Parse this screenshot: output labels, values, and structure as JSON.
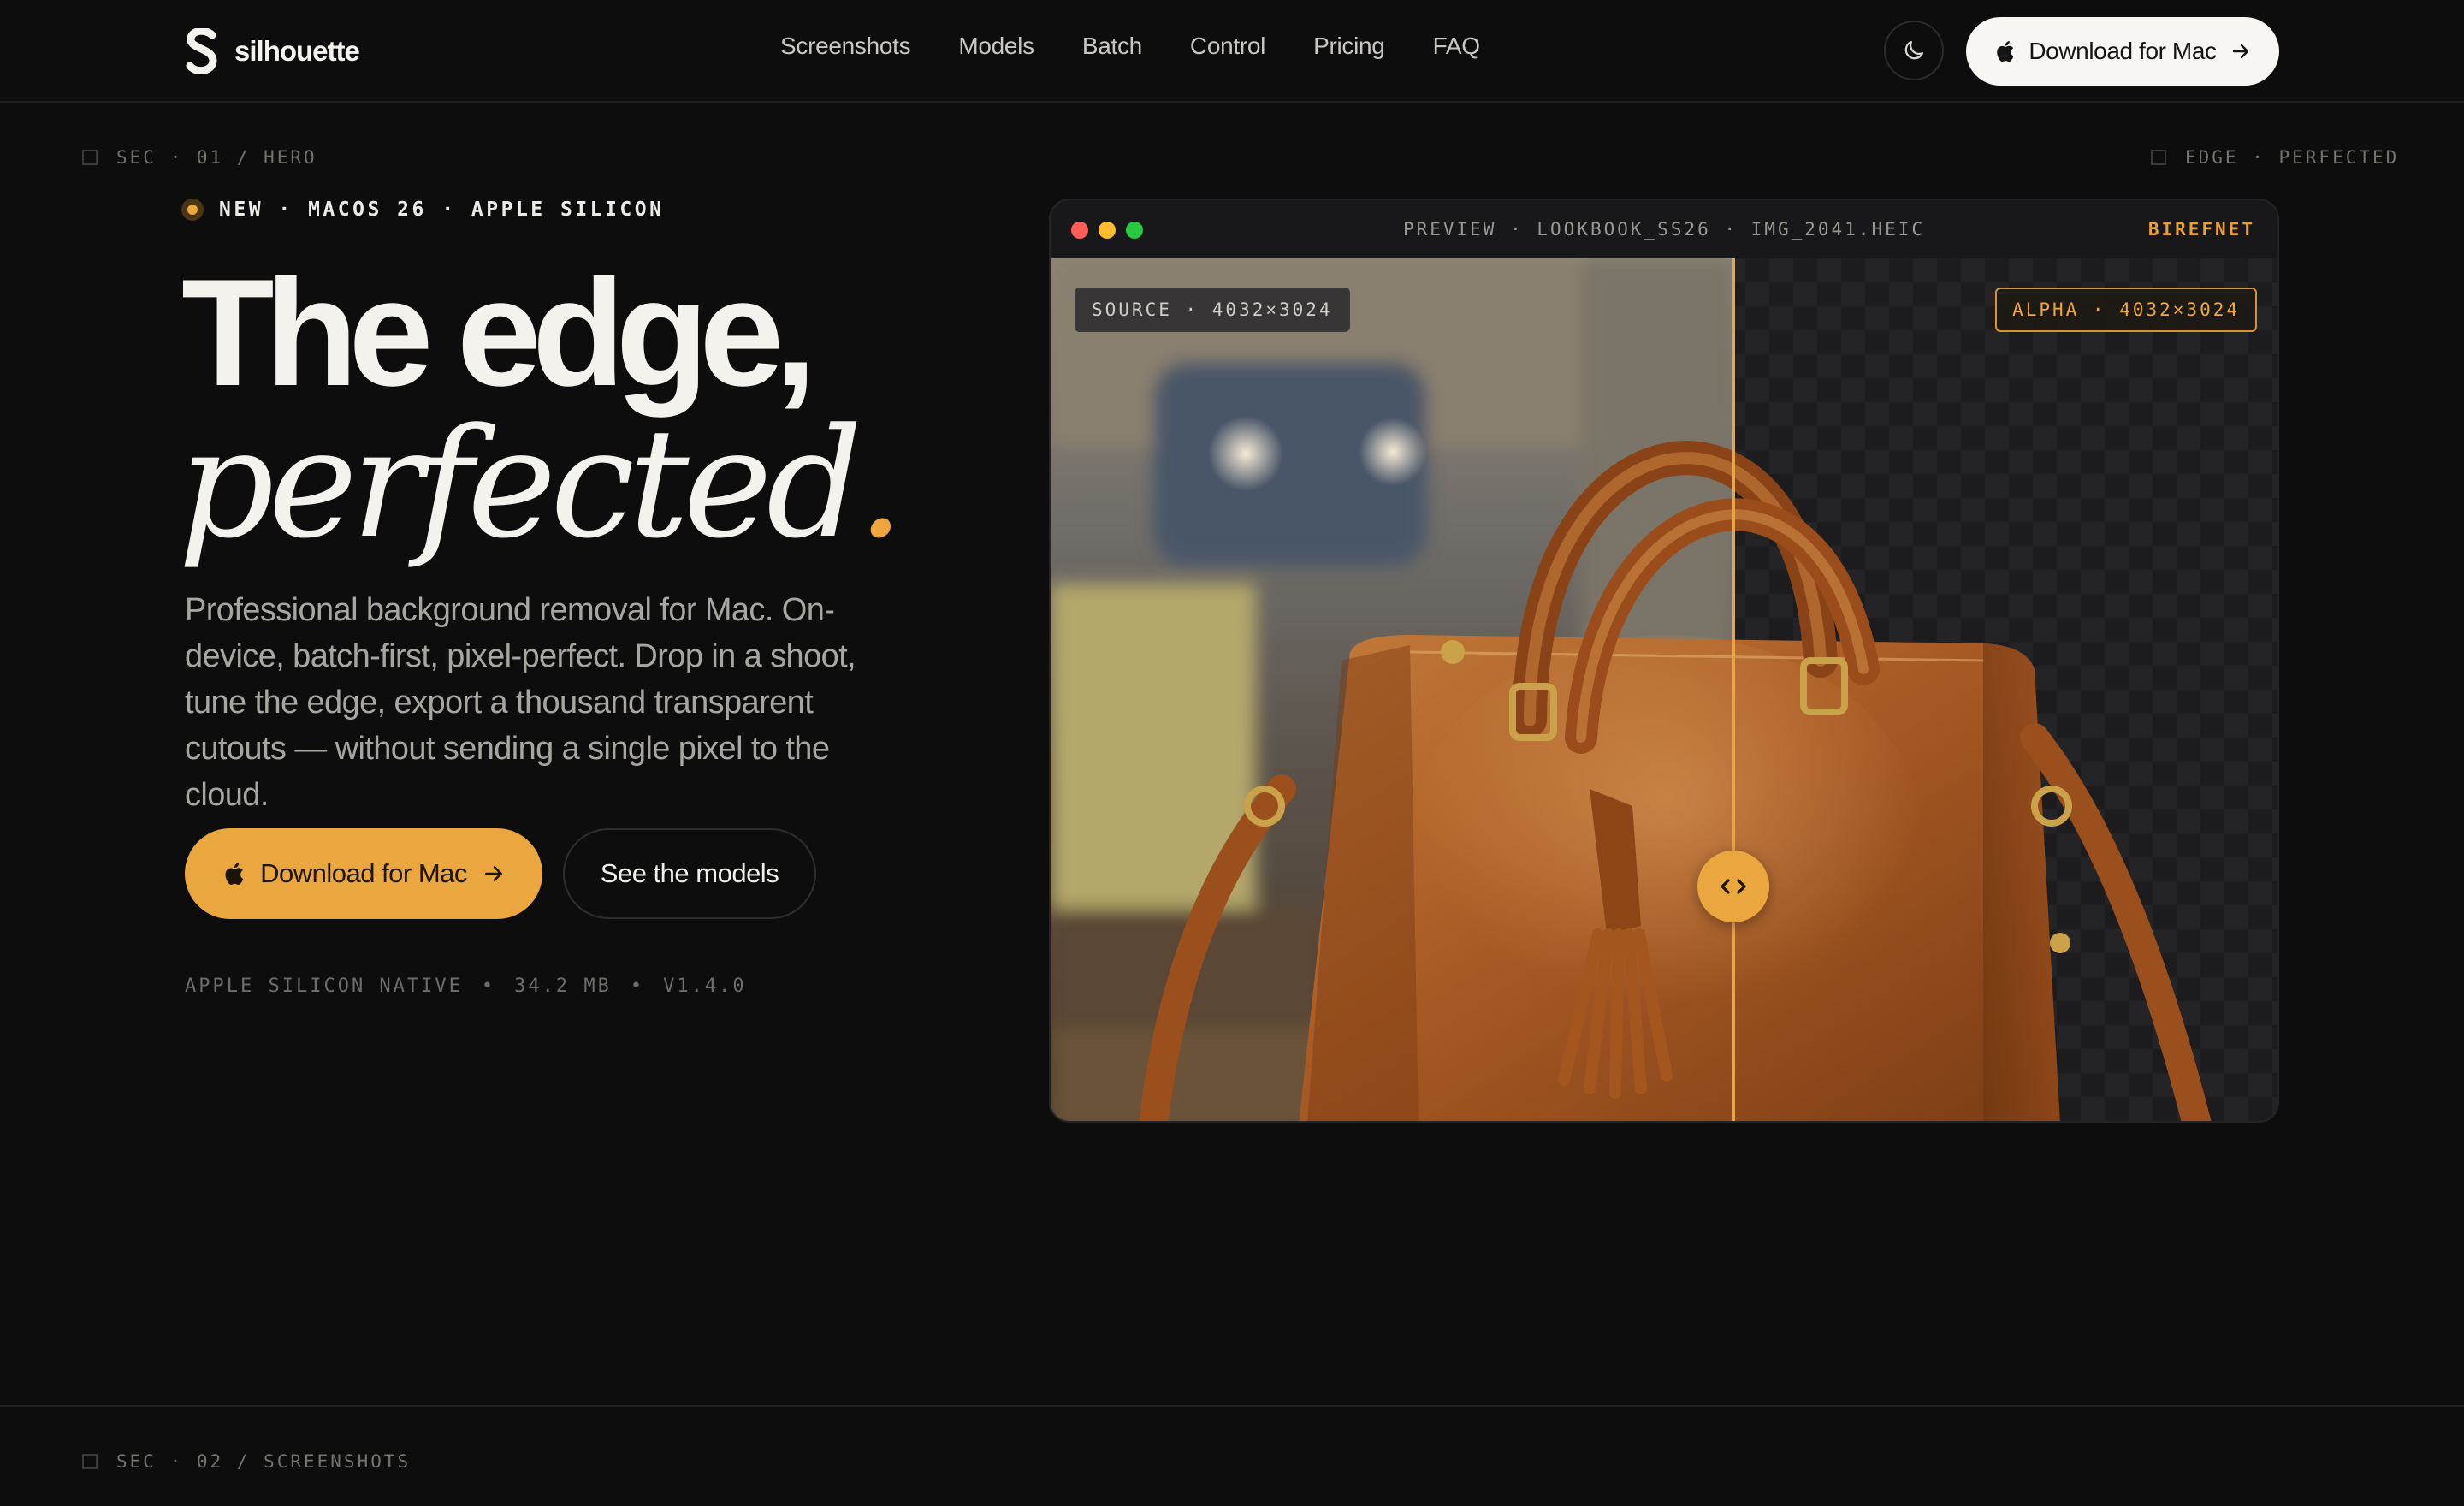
{
  "brand": {
    "name": "silhouette"
  },
  "nav": {
    "items": [
      "Screenshots",
      "Models",
      "Batch",
      "Control",
      "Pricing",
      "FAQ"
    ]
  },
  "header": {
    "download_label": "Download for Mac"
  },
  "sections": {
    "hero_marker": "SEC · 01 / HERO",
    "hero_right_marker": "EDGE · PERFECTED",
    "screenshots_marker": "SEC · 02 / SCREENSHOTS"
  },
  "hero": {
    "badge": "NEW · MACOS 26 · APPLE SILICON",
    "headline_line1": "The edge,",
    "headline_line2": "perfected",
    "headline_dot": ".",
    "lead": "Professional background removal for Mac. On-device, batch-first, pixel-perfect. Drop in a shoot, tune the edge, export a thousand transparent cutouts — without sending a single pixel to the cloud.",
    "primary_cta": "Download for Mac",
    "secondary_cta": "See the models",
    "meta": [
      "APPLE SILICON NATIVE",
      "34.2 MB",
      "V1.4.0"
    ],
    "meta_separator": "•"
  },
  "preview": {
    "title": "PREVIEW · LOOKBOOK_SS26 · IMG_2041.HEIC",
    "model": "BIREFNET",
    "source_tag": "SOURCE · 4032×3024",
    "alpha_tag": "ALPHA · 4032×3024",
    "split_fraction": 0.555
  },
  "colors": {
    "accent": "#eba73f",
    "background": "#0d0d0e",
    "text": "#f2f0ea"
  },
  "icons": {
    "theme": "moon-icon",
    "apple": "apple-icon",
    "arrow": "arrow-right-icon",
    "handle": "split-handle-icon"
  }
}
